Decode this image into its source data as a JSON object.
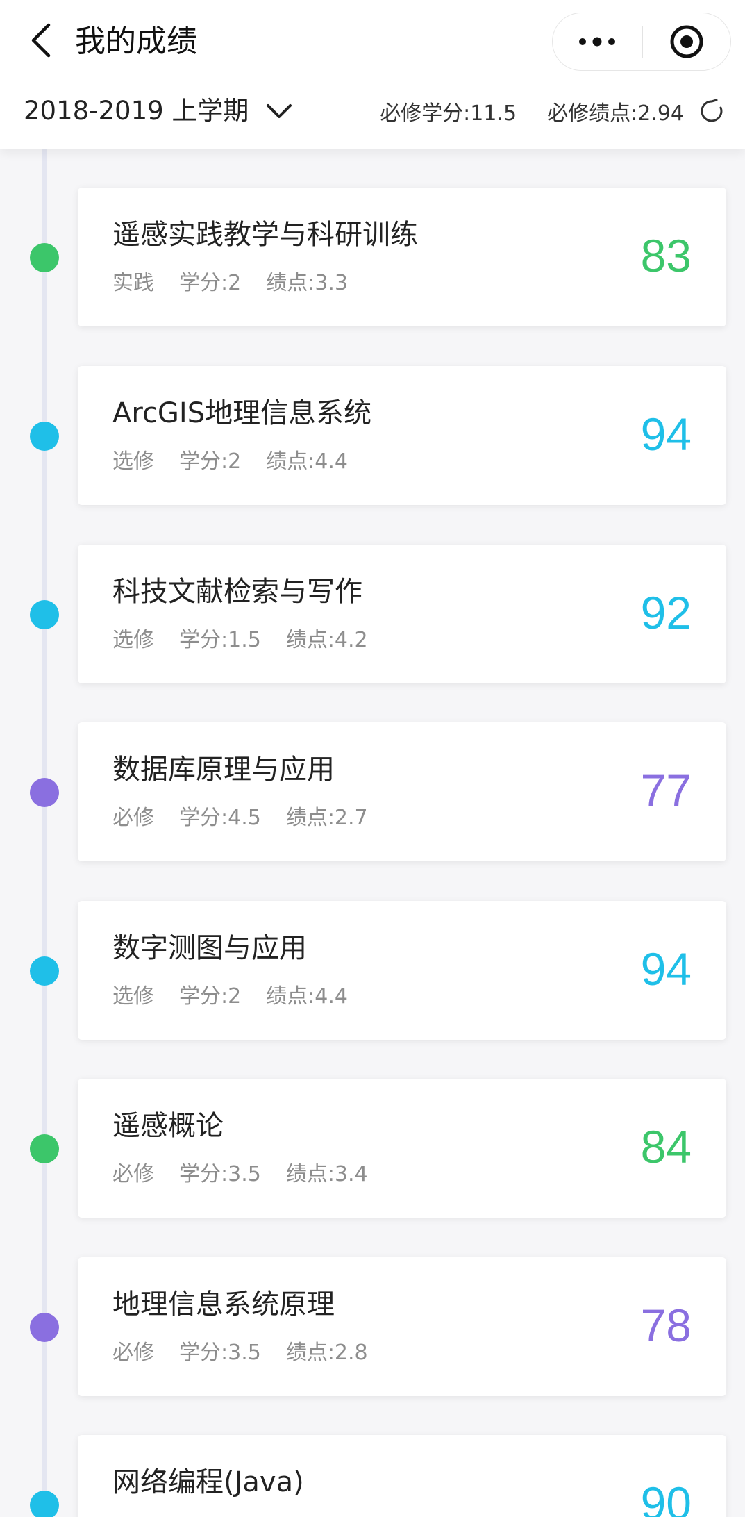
{
  "header": {
    "title": "我的成绩",
    "term": "2018-2019 上学期",
    "required_credits": "必修学分:11.5",
    "required_gpa": "必修绩点:2.94"
  },
  "colors": {
    "green": "#3cc66a",
    "cyan": "#1fbfe8",
    "purple": "#8a6fe0"
  },
  "courses": [
    {
      "name": "遥感实践教学与科研训练",
      "type": "实践",
      "credit": "学分:2",
      "gpa": "绩点:3.3",
      "score": "83",
      "color": "#3cc66a"
    },
    {
      "name": "ArcGIS地理信息系统",
      "type": "选修",
      "credit": "学分:2",
      "gpa": "绩点:4.4",
      "score": "94",
      "color": "#1fbfe8"
    },
    {
      "name": "科技文献检索与写作",
      "type": "选修",
      "credit": "学分:1.5",
      "gpa": "绩点:4.2",
      "score": "92",
      "color": "#1fbfe8"
    },
    {
      "name": "数据库原理与应用",
      "type": "必修",
      "credit": "学分:4.5",
      "gpa": "绩点:2.7",
      "score": "77",
      "color": "#8a6fe0"
    },
    {
      "name": "数字测图与应用",
      "type": "选修",
      "credit": "学分:2",
      "gpa": "绩点:4.4",
      "score": "94",
      "color": "#1fbfe8"
    },
    {
      "name": "遥感概论",
      "type": "必修",
      "credit": "学分:3.5",
      "gpa": "绩点:3.4",
      "score": "84",
      "color": "#3cc66a"
    },
    {
      "name": "地理信息系统原理",
      "type": "必修",
      "credit": "学分:3.5",
      "gpa": "绩点:2.8",
      "score": "78",
      "color": "#8a6fe0"
    },
    {
      "name": "网络编程(Java)",
      "type": "",
      "credit": "",
      "gpa": "",
      "score": "90",
      "color": "#1fbfe8"
    }
  ]
}
